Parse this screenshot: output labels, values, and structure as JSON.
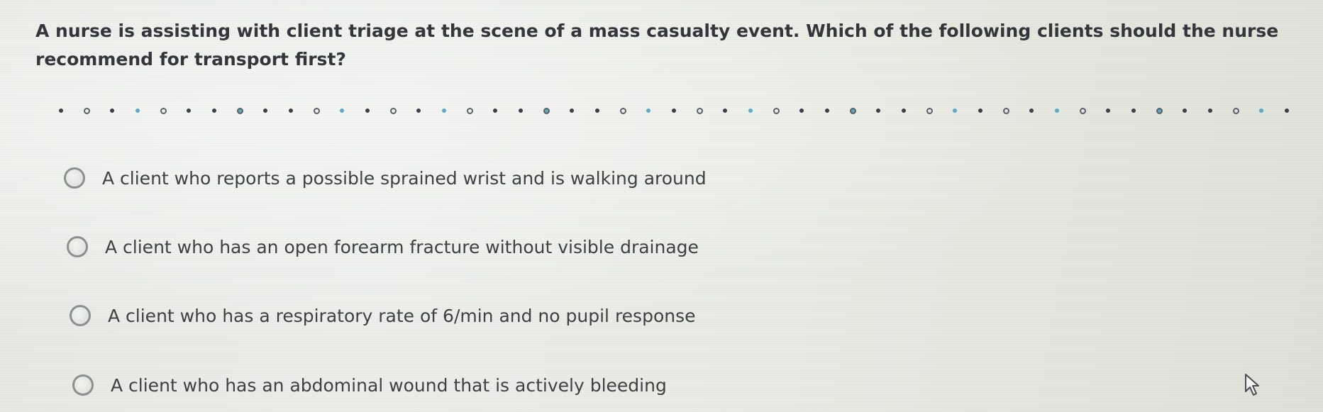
{
  "question": {
    "text": "A nurse is assisting with client triage at the scene of a mass casualty event. Which of the following clients should the nurse recommend for transport first?"
  },
  "options": [
    {
      "label": "A client who reports a possible sprained wrist and is walking around",
      "selected": false
    },
    {
      "label": "A client who has an open forearm fracture without visible drainage",
      "selected": false
    },
    {
      "label": "A client who has a respiratory rate of 6/min and no pupil response",
      "selected": false
    },
    {
      "label": "A client who has an abdominal wound that is actively bleeding",
      "selected": false
    }
  ],
  "colors": {
    "text": "#33373b",
    "divider_dot": "#3c4046",
    "divider_accent": "#5fa7c8",
    "radio_border": "#8a8f92"
  },
  "icons": {
    "cursor": "mouse-pointer-icon",
    "radio": "radio-button-icon"
  }
}
